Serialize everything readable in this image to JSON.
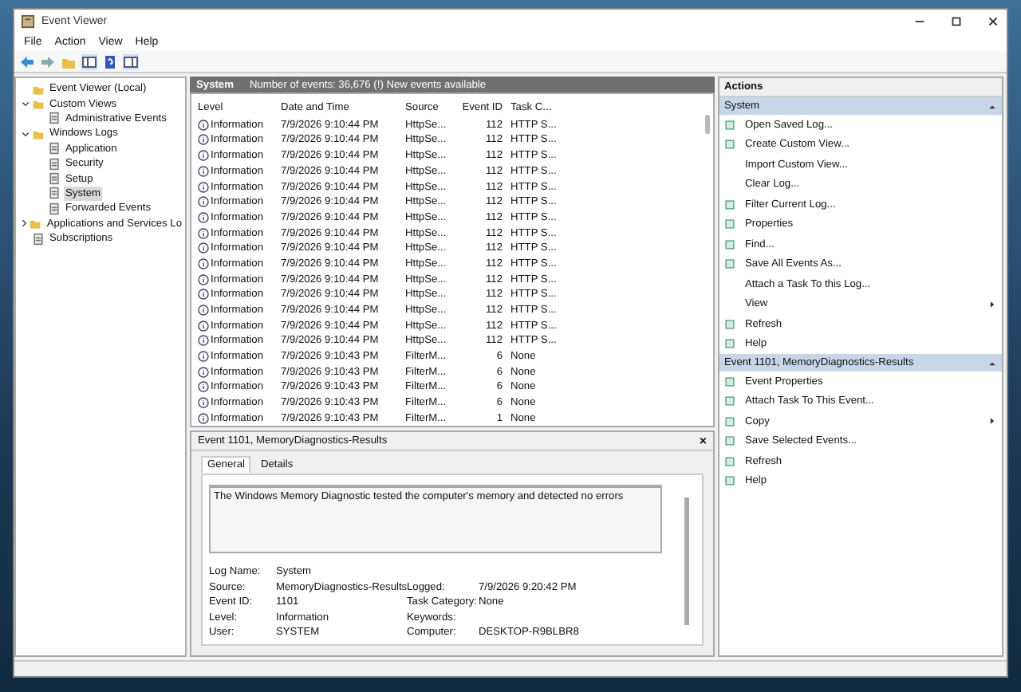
{
  "window": {
    "title": "Event Viewer"
  },
  "menu": [
    "File",
    "Action",
    "View",
    "Help"
  ],
  "tree": [
    {
      "label": "Event Viewer (Local)",
      "selected": false,
      "children": [
        {
          "label": "Custom Views",
          "selected": false,
          "expanded": true,
          "children": [
            {
              "label": "Administrative Events",
              "selected": false
            }
          ]
        },
        {
          "label": "Windows Logs",
          "selected": false,
          "expanded": true,
          "children": [
            {
              "label": "Application",
              "selected": false
            },
            {
              "label": "Security",
              "selected": false
            },
            {
              "label": "Setup",
              "selected": false
            },
            {
              "label": "System",
              "selected": true
            },
            {
              "label": "Forwarded Events",
              "selected": false
            }
          ]
        },
        {
          "label": "Applications and Services Lo",
          "selected": false,
          "expanded": false
        },
        {
          "label": "Subscriptions",
          "selected": false
        }
      ]
    }
  ],
  "log_header": {
    "title": "System",
    "summary": "Number of events: 36,676 (!) New events available"
  },
  "table": {
    "columns": [
      "Level",
      "Date and Time",
      "Source",
      "Event ID",
      "Task C..."
    ],
    "rows": [
      [
        "Information",
        "7/9/2026 9:10:44 PM",
        "HttpSe...",
        "112",
        "HTTP S..."
      ],
      [
        "Information",
        "7/9/2026 9:10:44 PM",
        "HttpSe...",
        "112",
        "HTTP S..."
      ],
      [
        "Information",
        "7/9/2026 9:10:44 PM",
        "HttpSe...",
        "112",
        "HTTP S..."
      ],
      [
        "Information",
        "7/9/2026 9:10:44 PM",
        "HttpSe...",
        "112",
        "HTTP S..."
      ],
      [
        "Information",
        "7/9/2026 9:10:44 PM",
        "HttpSe...",
        "112",
        "HTTP S..."
      ],
      [
        "Information",
        "7/9/2026 9:10:44 PM",
        "HttpSe...",
        "112",
        "HTTP S..."
      ],
      [
        "Information",
        "7/9/2026 9:10:44 PM",
        "HttpSe...",
        "112",
        "HTTP S..."
      ],
      [
        "Information",
        "7/9/2026 9:10:44 PM",
        "HttpSe...",
        "112",
        "HTTP S..."
      ],
      [
        "Information",
        "7/9/2026 9:10:44 PM",
        "HttpSe...",
        "112",
        "HTTP S..."
      ],
      [
        "Information",
        "7/9/2026 9:10:44 PM",
        "HttpSe...",
        "112",
        "HTTP S..."
      ],
      [
        "Information",
        "7/9/2026 9:10:44 PM",
        "HttpSe...",
        "112",
        "HTTP S..."
      ],
      [
        "Information",
        "7/9/2026 9:10:44 PM",
        "HttpSe...",
        "112",
        "HTTP S..."
      ],
      [
        "Information",
        "7/9/2026 9:10:44 PM",
        "HttpSe...",
        "112",
        "HTTP S..."
      ],
      [
        "Information",
        "7/9/2026 9:10:44 PM",
        "HttpSe...",
        "112",
        "HTTP S..."
      ],
      [
        "Information",
        "7/9/2026 9:10:44 PM",
        "HttpSe...",
        "112",
        "HTTP S..."
      ],
      [
        "Information",
        "7/9/2026 9:10:43 PM",
        "FilterM...",
        "6",
        "None"
      ],
      [
        "Information",
        "7/9/2026 9:10:43 PM",
        "FilterM...",
        "6",
        "None"
      ],
      [
        "Information",
        "7/9/2026 9:10:43 PM",
        "FilterM...",
        "6",
        "None"
      ],
      [
        "Information",
        "7/9/2026 9:10:43 PM",
        "FilterM...",
        "6",
        "None"
      ],
      [
        "Information",
        "7/9/2026 9:10:43 PM",
        "FilterM...",
        "1",
        "None"
      ]
    ]
  },
  "detail": {
    "title": "Event 1101, MemoryDiagnostics-Results",
    "close": "×",
    "tabs": [
      {
        "label": "General",
        "selected": true
      },
      {
        "label": "Details",
        "selected": false
      }
    ],
    "message": "The Windows Memory Diagnostic tested the computer's memory and detected no errors",
    "fields": [
      [
        {
          "label": "Log Name:",
          "value": "System"
        }
      ],
      [
        {
          "label": "Source:",
          "value": "MemoryDiagnostics-Results"
        },
        {
          "label": "Logged:",
          "value": "7/9/2026 9:20:42 PM"
        }
      ],
      [
        {
          "label": "Event ID:",
          "value": "1101"
        },
        {
          "label": "Task Category:",
          "value": "None"
        }
      ],
      [
        {
          "label": "Level:",
          "value": "Information"
        },
        {
          "label": "Keywords:"
        }
      ],
      [
        {
          "label": "User:",
          "value": "SYSTEM"
        },
        {
          "label": "Computer:",
          "value": "DESKTOP-R9BLBR8"
        }
      ]
    ]
  },
  "actions": {
    "title": "Actions",
    "sections": [
      {
        "title": "System",
        "items": [
          {
            "label": "Open Saved Log...",
            "icon": true,
            "submenu": false
          },
          {
            "label": "Create Custom View...",
            "icon": true,
            "submenu": false
          },
          {
            "label": "Import Custom View...",
            "icon": false,
            "submenu": false
          },
          {
            "label": "Clear Log...",
            "icon": false,
            "submenu": false
          },
          {
            "label": "Filter Current Log...",
            "icon": true,
            "submenu": false
          },
          {
            "label": "Properties",
            "icon": true,
            "submenu": false
          },
          {
            "label": "Find...",
            "icon": true,
            "submenu": false
          },
          {
            "label": "Save All Events As...",
            "icon": true,
            "submenu": false
          },
          {
            "label": "Attach a Task To this Log...",
            "icon": false,
            "submenu": false
          },
          {
            "label": "View",
            "icon": false,
            "submenu": true
          },
          {
            "label": "Refresh",
            "icon": true,
            "submenu": false
          },
          {
            "label": "Help",
            "icon": true,
            "submenu": false
          }
        ]
      },
      {
        "title": "Event 1101, MemoryDiagnostics-Results",
        "items": [
          {
            "label": "Event Properties",
            "icon": true,
            "submenu": false
          },
          {
            "label": "Attach Task To This Event...",
            "icon": true,
            "submenu": false
          },
          {
            "label": "Copy",
            "icon": true,
            "submenu": true
          },
          {
            "label": "Save Selected Events...",
            "icon": true,
            "submenu": false
          },
          {
            "label": "Refresh",
            "icon": true,
            "submenu": false
          },
          {
            "label": "Help",
            "icon": true,
            "submenu": false
          }
        ]
      }
    ]
  }
}
